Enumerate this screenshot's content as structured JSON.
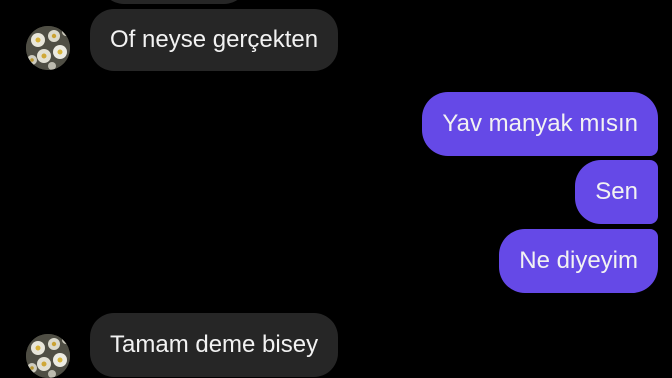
{
  "conversation": {
    "messages": [
      {
        "direction": "incoming",
        "text": "Of neyse gerçekten",
        "has_avatar": true
      },
      {
        "direction": "outgoing",
        "text": "Yav manyak mısın"
      },
      {
        "direction": "outgoing",
        "text": "Sen"
      },
      {
        "direction": "outgoing",
        "text": "Ne diyeyim"
      },
      {
        "direction": "incoming",
        "text": "Tamam deme bisey",
        "has_avatar": true
      }
    ]
  },
  "colors": {
    "background": "#000000",
    "incoming_bubble": "#262626",
    "outgoing_bubble": "#6549e7",
    "text": "#f2f2f2"
  },
  "icons": {
    "avatar": "daisy-flowers-avatar-icon"
  }
}
